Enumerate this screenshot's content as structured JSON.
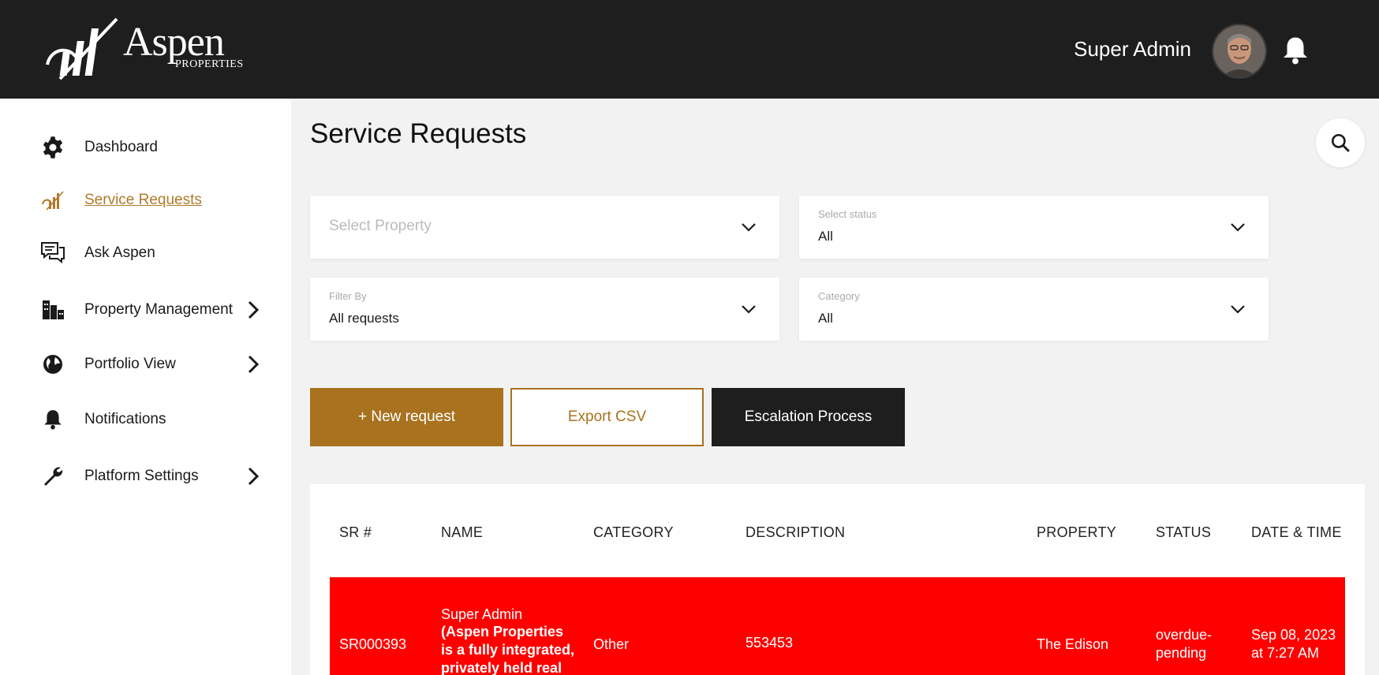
{
  "header": {
    "logo_word": "Aspen",
    "logo_sub": "PROPERTIES",
    "user_name": "Super Admin"
  },
  "sidebar": {
    "items": [
      {
        "label": "Dashboard",
        "icon": "gear-icon"
      },
      {
        "label": "Service Requests",
        "icon": "aspen-logo-icon",
        "active": true
      },
      {
        "label": "Ask Aspen",
        "icon": "chat-icon"
      },
      {
        "label": "Property Management",
        "icon": "buildings-icon",
        "expandable": true
      },
      {
        "label": "Portfolio View",
        "icon": "globe-icon",
        "expandable": true
      },
      {
        "label": "Notifications",
        "icon": "bell-icon"
      },
      {
        "label": "Platform Settings",
        "icon": "wrench-icon",
        "expandable": true
      }
    ]
  },
  "main": {
    "title": "Service Requests",
    "filters": {
      "property": {
        "placeholder": "Select Property"
      },
      "status": {
        "label": "Select status",
        "value": "All"
      },
      "filter_by": {
        "label": "Filter By",
        "value": "All requests"
      },
      "category": {
        "label": "Category",
        "value": "All"
      }
    },
    "buttons": {
      "new_request": "+ New request",
      "export_csv": "Export CSV",
      "escalation": "Escalation Process"
    },
    "table": {
      "columns": [
        "SR #",
        "NAME",
        "CATEGORY",
        "DESCRIPTION",
        "PROPERTY",
        "STATUS",
        "DATE & TIME"
      ],
      "rows": [
        {
          "sr": "SR000393",
          "name": "Super Admin",
          "name_detail": "(Aspen Properties is a fully integrated, privately held real",
          "category": "Other",
          "description": "553453",
          "property": "The Edison",
          "status_line1": "overdue-",
          "status_line2": "pending",
          "date_line1": "Sep 08, 2023",
          "date_line2": "at 7:27 AM"
        }
      ]
    }
  },
  "colors": {
    "topbar": "#1e1e1e",
    "accent": "#a8721f",
    "overdue_row": "#ff0000",
    "background": "#f2f2f2"
  }
}
